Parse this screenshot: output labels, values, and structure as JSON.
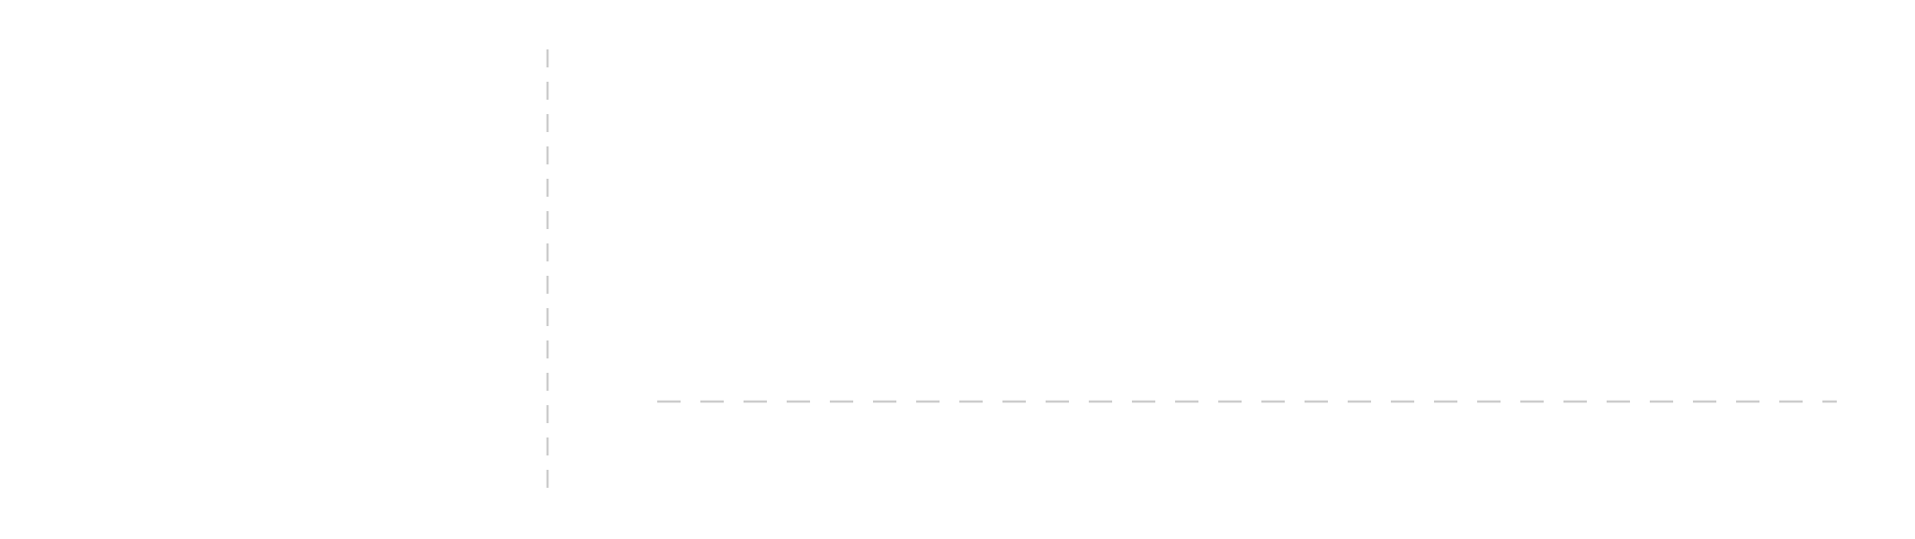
{
  "colors": {
    "background": "#ffffff",
    "guide_line": "#cccccc"
  },
  "guides": {
    "vertical_style": "dashed",
    "horizontal_style": "dashed"
  }
}
